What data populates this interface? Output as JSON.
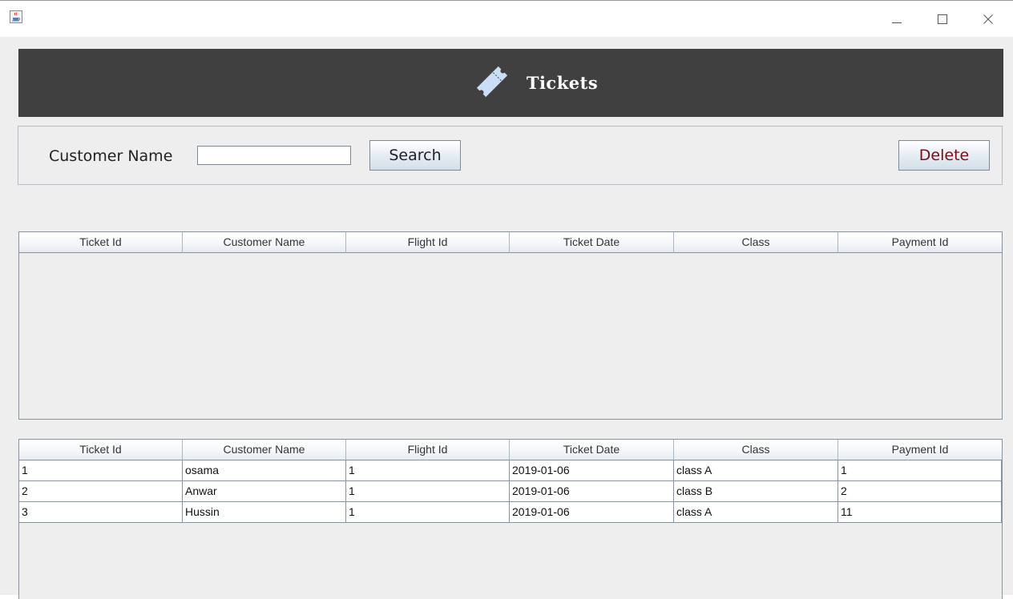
{
  "window": {
    "app_icon": "java-cup-icon",
    "controls": [
      "minimize-icon",
      "maximize-icon",
      "close-icon"
    ]
  },
  "header": {
    "title": "Tickets",
    "icon": "ticket-icon",
    "background": "#404040"
  },
  "search": {
    "label": "Customer Name",
    "value": "",
    "placeholder": "",
    "search_button": "Search",
    "delete_button": "Delete",
    "delete_color": "#7a0f0f"
  },
  "top_table": {
    "columns": [
      "Ticket Id",
      "Customer Name",
      "Flight Id",
      "Ticket Date",
      "Class",
      "Payment Id"
    ],
    "rows": []
  },
  "bottom_table": {
    "columns": [
      "Ticket Id",
      "Customer Name",
      "Flight Id",
      "Ticket Date",
      "Class",
      "Payment Id"
    ],
    "rows": [
      [
        "1",
        "osama",
        "1",
        "2019-01-06",
        "class A",
        "1"
      ],
      [
        "2",
        "Anwar",
        "1",
        "2019-01-06",
        "class B",
        "2"
      ],
      [
        "3",
        "Hussin",
        "1",
        "2019-01-06",
        "class A",
        "11"
      ]
    ]
  }
}
